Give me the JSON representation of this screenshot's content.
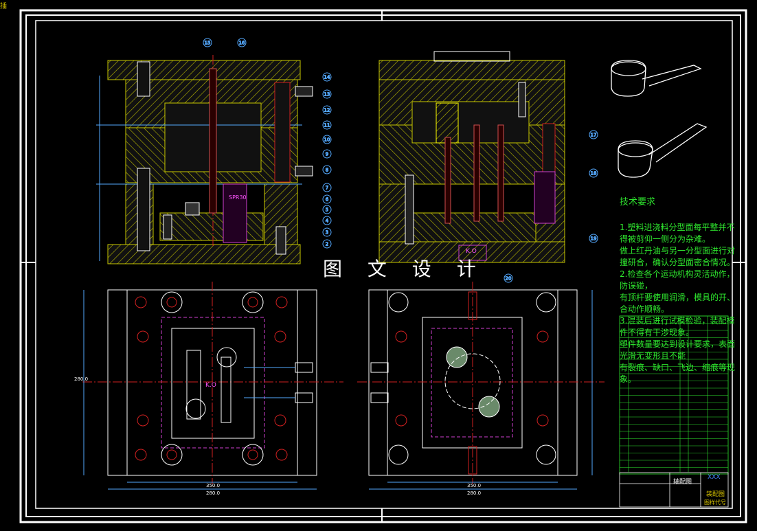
{
  "corner_label": "插",
  "watermark": "图 文 设 计",
  "tech_requirements": {
    "title": "技术要求",
    "lines": [
      "1.塑料进浇料分型面每平整并不得被剪仰一侧分为杂难。",
      "做上红丹油与另一分型面进行对撞研合，确认分型面密合情况。",
      "2.检查各个运动机构灵活动作，防误碰，",
      "有顶杆要使用润滑，模具的开、合动作顺畅。",
      "3.混装后进行试模检验，装配模件不得有干涉现象。",
      "塑件数量要达到设计要求，表面光滑无变形且不能",
      "有裂痕、缺口、飞边、缩痕等现象。"
    ]
  },
  "balloons": [
    "15",
    "16",
    "14",
    "13",
    "12",
    "11",
    "10",
    "9",
    "8",
    "7",
    "6",
    "5",
    "4",
    "3",
    "2",
    "17",
    "18",
    "19",
    "20"
  ],
  "dimensions": {
    "top_length": "350.0",
    "top_length2": "350.0",
    "total_width": "280.0",
    "side_height": "280.0",
    "total_width2": "280.0"
  },
  "labels": {
    "spring": "SPR30",
    "ko": "K.O",
    "ko2": "K.O"
  },
  "title_block": {
    "drawing_name": "轴配图",
    "type": "装配图",
    "company": "XXX",
    "drawing_no": "图样代号"
  }
}
